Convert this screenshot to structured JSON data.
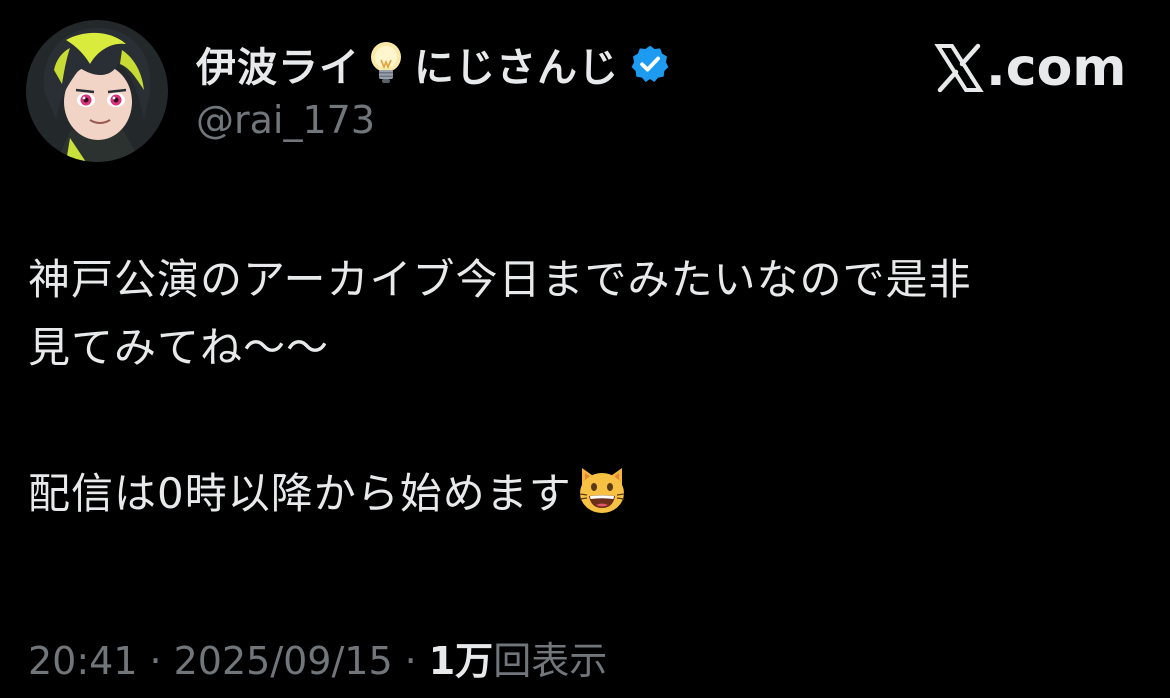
{
  "author": {
    "display_name": "伊波ライ",
    "name_emoji_icon": "lightbulb-icon",
    "org": "にじさんじ",
    "verified": true,
    "verified_color": "#1d9bf0",
    "handle": "@rai_173",
    "avatar_icon": "anime-avatar"
  },
  "site": {
    "logo_icon": "x-logo-icon",
    "label": ".com"
  },
  "tweet": {
    "line1": "神戸公演のアーカイブ今日までみたいなので是非",
    "line2": "見てみてね〜〜",
    "line3": "配信は0時以降から始めます",
    "emoji_icon": "grinning-cat-emoji"
  },
  "meta": {
    "time": "20:41",
    "separator": "·",
    "date": "2025/09/15",
    "views_count": "1万",
    "views_label": "回表示"
  },
  "colors": {
    "background": "#000000",
    "text": "#e7e9ea",
    "secondary_text": "#71767b",
    "accent": "#1d9bf0"
  }
}
